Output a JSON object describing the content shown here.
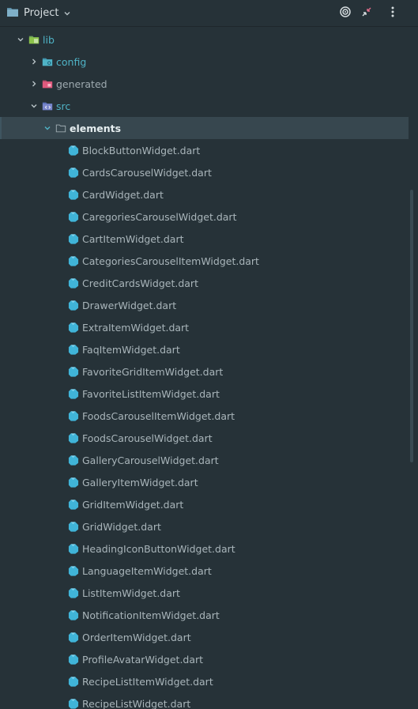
{
  "header": {
    "title": "Project",
    "icons": [
      "folder-icon",
      "chevron-down-icon",
      "target-icon",
      "collapse-icon",
      "more-vertical-icon"
    ]
  },
  "tree": {
    "lib": "lib",
    "config": "config",
    "generated": "generated",
    "src": "src",
    "elements": "elements",
    "files": [
      "BlockButtonWidget.dart",
      "CardsCarouselWidget.dart",
      "CardWidget.dart",
      "CaregoriesCarouselWidget.dart",
      "CartItemWidget.dart",
      "CategoriesCarouselItemWidget.dart",
      "CreditCardsWidget.dart",
      "DrawerWidget.dart",
      "ExtraItemWidget.dart",
      "FaqItemWidget.dart",
      "FavoriteGridItemWidget.dart",
      "FavoriteListItemWidget.dart",
      "FoodsCarouselItemWidget.dart",
      "FoodsCarouselWidget.dart",
      "GalleryCarouselWidget.dart",
      "GalleryItemWidget.dart",
      "GridItemWidget.dart",
      "GridWidget.dart",
      "HeadingIconButtonWidget.dart",
      "LanguageItemWidget.dart",
      "ListItemWidget.dart",
      "NotificationItemWidget.dart",
      "OrderItemWidget.dart",
      "ProfileAvatarWidget.dart",
      "RecipeListItemWidget.dart",
      "RecipeListWidget.dart"
    ]
  },
  "colors": {
    "background": "#263238",
    "selected_row": "#37474f",
    "teal_text": "#4fb3c6",
    "dart_icon": "#40b4d8"
  }
}
